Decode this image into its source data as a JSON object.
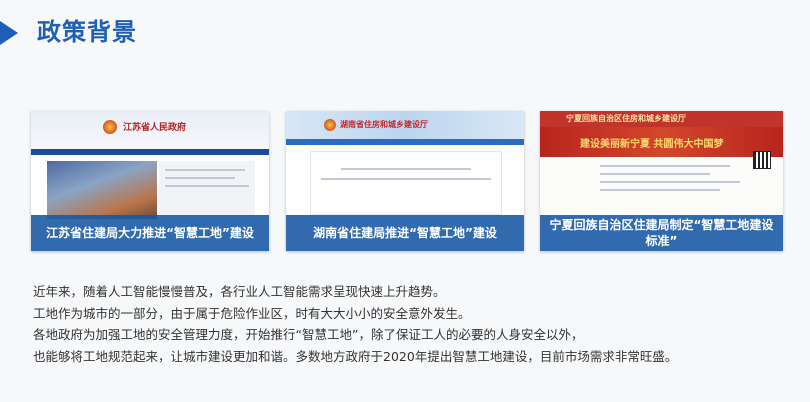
{
  "header": {
    "title": "政策背景"
  },
  "cards": [
    {
      "caption": "江苏省住建局大力推进“智慧工地”建设",
      "logo_text": "江苏省人民政府"
    },
    {
      "caption": "湖南省住建局推进“智慧工地”建设",
      "logo_text": "湖南省住房和城乡建设厅"
    },
    {
      "caption": "宁夏回族自治区住建局制定“智慧工地建设标准”",
      "logo_text": "宁夏回族自治区住房和城乡建设厅",
      "banner_text": "建设美丽新宁夏 共圆伟大中国梦"
    }
  ],
  "paragraphs": [
    "近年来，随着人工智能慢慢普及，各行业人工智能需求呈现快速上升趋势。",
    "工地作为城市的一部分，由于属于危险作业区，时有大大小小的安全意外发生。",
    "各地政府为加强工地的安全管理力度，开始推行“智慧工地”，除了保证工人的必要的人身安全以外，",
    "也能够将工地规范起来，让城市建设更加和谐。多数地方政府于2020年提出智慧工地建设，目前市场需求非常旺盛。"
  ],
  "colors": {
    "accent": "#1f5fb5",
    "caption_bg": "#1656a2",
    "ningxia_red": "#c0342b"
  }
}
